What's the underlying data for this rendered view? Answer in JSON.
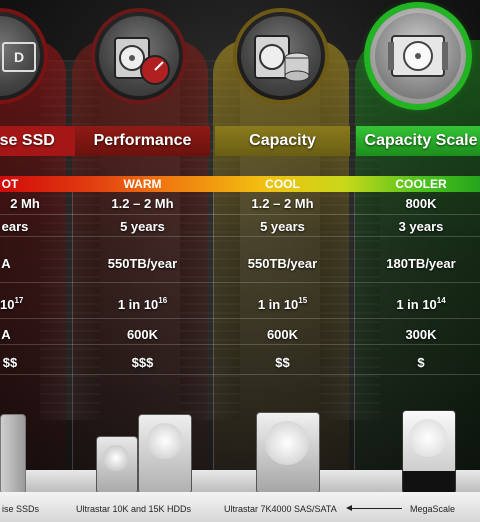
{
  "columns": [
    {
      "header": "ise SSD",
      "temp": "OT"
    },
    {
      "header": "Performance",
      "temp": "WARM"
    },
    {
      "header": "Capacity",
      "temp": "COOL"
    },
    {
      "header": "Capacity Scale",
      "temp": "COOLER"
    }
  ],
  "partial_icon_text": "D",
  "rows": [
    {
      "c0": "2 Mh",
      "c1": "1.2 – 2 Mh",
      "c2": "1.2 – 2 Mh",
      "c3": "800K"
    },
    {
      "c0": "ears",
      "c1": "5 years",
      "c2": "5 years",
      "c3": "3 years"
    },
    {
      "c0": "A",
      "c1": "550TB/year",
      "c2": "550TB/year",
      "c3": "180TB/year"
    },
    {
      "c0_base": "10",
      "c0_exp": "17",
      "c1_base": "1 in 10",
      "c1_exp": "16",
      "c2_base": "1 in 10",
      "c2_exp": "15",
      "c3_base": "1 in 10",
      "c3_exp": "14"
    },
    {
      "c0": "A",
      "c1": "600K",
      "c2": "600K",
      "c3": "300K"
    },
    {
      "c0": "$$",
      "c1": "$$$",
      "c2": "$$",
      "c3": "$"
    }
  ],
  "footer": {
    "f0": "ise SSDs",
    "f1": "Ultrastar 10K and 15K HDDs",
    "f2": "Ultrastar 7K4000 SAS/SATA",
    "f3": "MegaScale"
  },
  "icons": [
    "ssd-icon",
    "performance-drive-gauge-icon",
    "capacity-drive-database-icon",
    "capacity-scale-drive-icon"
  ]
}
